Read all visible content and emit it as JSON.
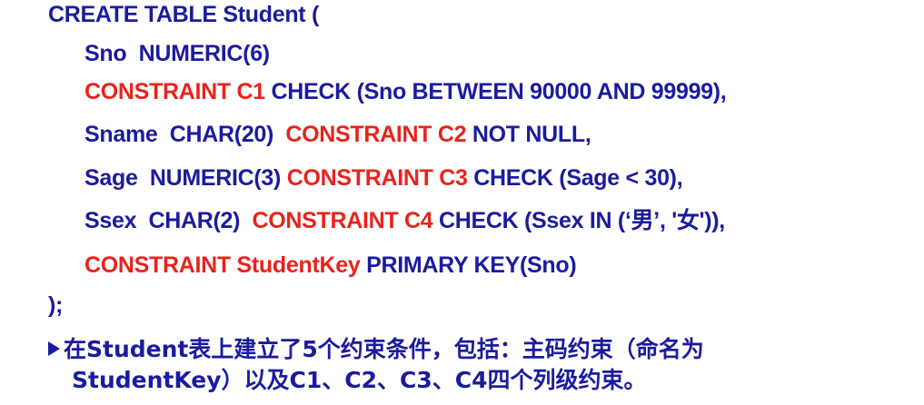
{
  "code": {
    "line0": "CREATE TABLE Student (",
    "line1": "Sno  NUMERIC(6)",
    "line2": {
      "red": "CONSTRAINT C1",
      "blue": " CHECK (Sno BETWEEN 90000 AND 99999),"
    },
    "line3": {
      "blue1": "Sname  CHAR(20)  ",
      "red": "CONSTRAINT C2",
      "blue2": " NOT NULL,"
    },
    "line4": {
      "blue1": "Sage  NUMERIC(3) ",
      "red": "CONSTRAINT C3",
      "blue2": " CHECK (Sage < 30),"
    },
    "line5": {
      "blue1": "Ssex  CHAR(2)  ",
      "red": "CONSTRAINT C4",
      "blue2": " CHECK (Ssex IN (‘男’, '女')),"
    },
    "line6": {
      "red": "CONSTRAINT StudentKey",
      "blue": " PRIMARY KEY(Sno)"
    },
    "line7": ");"
  },
  "note": {
    "line1": "在Student表上建立了5个约束条件，包括：主码约束（命名为",
    "line2": "StudentKey）以及C1、C2、C3、C4四个列级约束。"
  },
  "colors": {
    "text_blue": "#1b1b9e",
    "keyword_red": "#e8231c"
  },
  "icons": {
    "bullet": "triangle-bullet-icon"
  }
}
